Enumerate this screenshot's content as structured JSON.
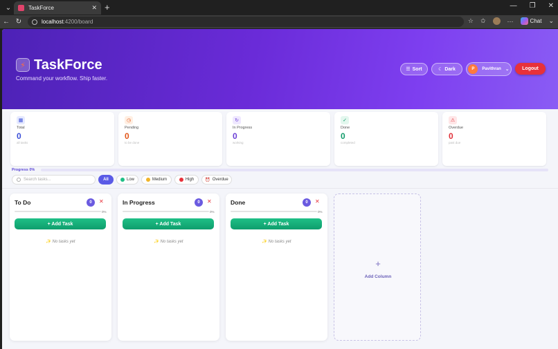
{
  "browser": {
    "tab_title": "TaskForce",
    "url_host": "localhost",
    "url_path": ":4200/board",
    "chat_label": "Chat"
  },
  "header": {
    "brand": "TaskForce",
    "tagline": "Command your workflow. Ship faster.",
    "sort_label": "Sort",
    "dark_label": "Dark",
    "user_initial": "P",
    "user_name": "Pavithran",
    "logout_label": "Logout"
  },
  "stats": [
    {
      "label": "Total",
      "value": "0",
      "sub": "all tasks",
      "color": "#3b4fd8",
      "icon_bg": "#e6eaff",
      "icon": "grid-icon"
    },
    {
      "label": "Pending",
      "value": "0",
      "sub": "to be done",
      "color": "#e2561a",
      "icon_bg": "#ffefe3",
      "icon": "clock-icon"
    },
    {
      "label": "In Progress",
      "value": "0",
      "sub": "working",
      "color": "#6b3fd6",
      "icon_bg": "#efe8ff",
      "icon": "refresh-icon"
    },
    {
      "label": "Done",
      "value": "0",
      "sub": "completed",
      "color": "#129b6a",
      "icon_bg": "#e3f7ee",
      "icon": "check-icon"
    },
    {
      "label": "Overdue",
      "value": "0",
      "sub": "past due",
      "color": "#e0313a",
      "icon_bg": "#ffe6e7",
      "icon": "warning-icon"
    }
  ],
  "progress": {
    "label": "Progress 0%",
    "value": 0
  },
  "search": {
    "placeholder": "Search tasks..."
  },
  "filters": [
    {
      "label": "All",
      "active": true
    },
    {
      "label": "Low",
      "dot": "#1fbf86"
    },
    {
      "label": "Medium",
      "dot": "#f0b429"
    },
    {
      "label": "High",
      "dot": "#e8313a"
    },
    {
      "label": "Overdue",
      "icon": "alarm-icon"
    }
  ],
  "columns": [
    {
      "title": "To Do",
      "count": "0",
      "pct": "0%",
      "add_label": "+ Add Task",
      "empty": "✨ No tasks yet"
    },
    {
      "title": "In Progress",
      "count": "0",
      "pct": "0%",
      "add_label": "+ Add Task",
      "empty": "✨ No tasks yet"
    },
    {
      "title": "Done",
      "count": "0",
      "pct": "0%",
      "add_label": "+ Add Task",
      "empty": "✨ No tasks yet"
    }
  ],
  "add_column": {
    "plus": "+",
    "label": "Add Column"
  }
}
